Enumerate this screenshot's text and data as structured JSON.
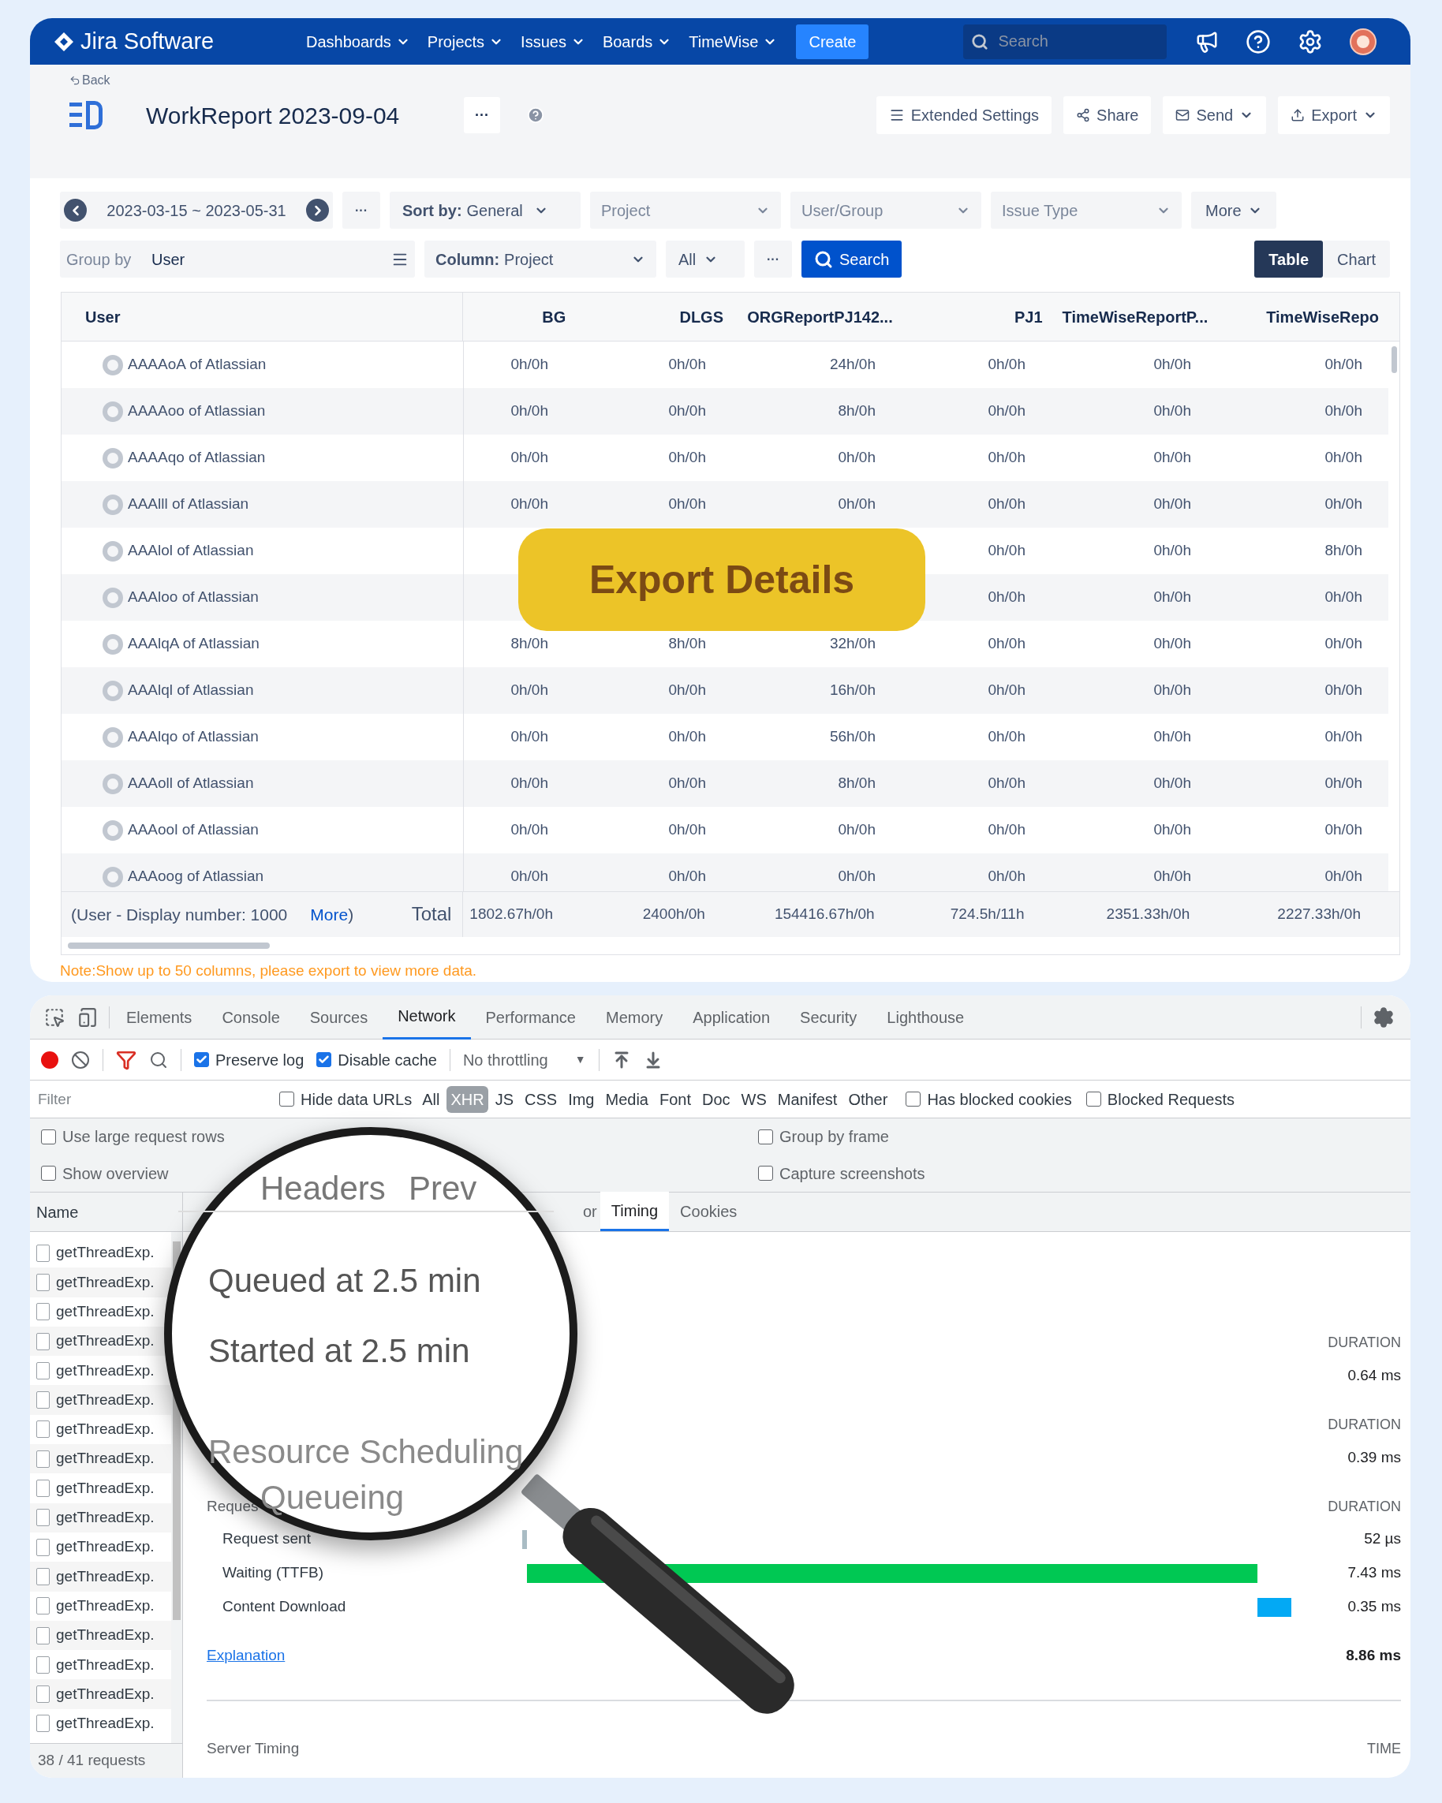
{
  "nav": {
    "logo": "Jira Software",
    "items": [
      {
        "label": "Dashboards"
      },
      {
        "label": "Projects"
      },
      {
        "label": "Issues"
      },
      {
        "label": "Boards"
      },
      {
        "label": "TimeWise"
      }
    ],
    "create": "Create",
    "search_placeholder": "Search"
  },
  "header": {
    "back": "Back",
    "title": "WorkReport 2023-09-04",
    "more": "···",
    "actions": [
      {
        "label": "Extended Settings",
        "kind": "settings"
      },
      {
        "label": "Share",
        "kind": "share"
      },
      {
        "label": "Send",
        "kind": "send"
      },
      {
        "label": "Export",
        "kind": "export"
      }
    ]
  },
  "filters": {
    "date_range": "2023-03-15 ~ 2023-05-31",
    "more": "···",
    "sort_label": "Sort by:",
    "sort_value": "General",
    "dropdowns": [
      {
        "placeholder": "Project"
      },
      {
        "placeholder": "User/Group"
      },
      {
        "placeholder": "Issue Type"
      }
    ],
    "more_button": "More",
    "group_label": "Group by",
    "group_value": "User",
    "column_label": "Column:",
    "column_value": "Project",
    "scope": "All",
    "options": "···",
    "search": "Search",
    "views": [
      {
        "label": "Table",
        "selected": true
      },
      {
        "label": "Chart",
        "selected": false
      }
    ]
  },
  "table": {
    "columns": [
      "User",
      "BG",
      "DLGS",
      "ORGReportPJ142...",
      "PJ1",
      "TimeWiseReportP...",
      "TimeWiseRepo"
    ],
    "rows": [
      {
        "user": "AAAAoA of Atlassian",
        "values": [
          "0h/0h",
          "0h/0h",
          "24h/0h",
          "0h/0h",
          "0h/0h",
          "0h/0h"
        ]
      },
      {
        "user": "AAAAoo of Atlassian",
        "values": [
          "0h/0h",
          "0h/0h",
          "8h/0h",
          "0h/0h",
          "0h/0h",
          "0h/0h"
        ]
      },
      {
        "user": "AAAAqo of Atlassian",
        "values": [
          "0h/0h",
          "0h/0h",
          "0h/0h",
          "0h/0h",
          "0h/0h",
          "0h/0h"
        ]
      },
      {
        "user": "AAAlll of Atlassian",
        "values": [
          "0h/0h",
          "0h/0h",
          "0h/0h",
          "0h/0h",
          "0h/0h",
          "0h/0h"
        ]
      },
      {
        "user": "AAAlol of Atlassian",
        "values": [
          "0h/0h",
          "0h/0h",
          "8h/0h"
        ]
      },
      {
        "user": "AAAloo of Atlassian",
        "values": [
          "0h/0h",
          "0h/0h",
          "0h/0h"
        ]
      },
      {
        "user": "AAAlqA of Atlassian",
        "values": [
          "8h/0h",
          "8h/0h",
          "32h/0h",
          "0h/0h",
          "0h/0h",
          "0h/0h"
        ]
      },
      {
        "user": "AAAlql of Atlassian",
        "values": [
          "0h/0h",
          "0h/0h",
          "16h/0h",
          "0h/0h",
          "0h/0h",
          "0h/0h"
        ]
      },
      {
        "user": "AAAlqo of Atlassian",
        "values": [
          "0h/0h",
          "0h/0h",
          "56h/0h",
          "0h/0h",
          "0h/0h",
          "0h/0h"
        ]
      },
      {
        "user": "AAAoll of Atlassian",
        "values": [
          "0h/0h",
          "0h/0h",
          "8h/0h",
          "0h/0h",
          "0h/0h",
          "0h/0h"
        ]
      },
      {
        "user": "AAAool of Atlassian",
        "values": [
          "0h/0h",
          "0h/0h",
          "0h/0h",
          "0h/0h",
          "0h/0h",
          "0h/0h"
        ]
      },
      {
        "user": "AAAoog of Atlassian",
        "values": [
          "0h/0h",
          "0h/0h",
          "0h/0h",
          "0h/0h",
          "0h/0h",
          "0h/0h"
        ]
      }
    ],
    "footer": {
      "display": "(User - Display number: 1000",
      "more": "More",
      "close": ")",
      "total_label": "Total",
      "totals": [
        "1802.67h/0h",
        "2400h/0h",
        "154416.67h/0h",
        "724.5h/11h",
        "2351.33h/0h",
        "2227.33h/0h"
      ]
    }
  },
  "note": "Note:Show up to 50 columns, please export to view more data.",
  "banner": "Export Details",
  "devtools": {
    "tabs": [
      {
        "label": "Elements",
        "selected": false
      },
      {
        "label": "Console",
        "selected": false
      },
      {
        "label": "Sources",
        "selected": false
      },
      {
        "label": "Network",
        "selected": true
      },
      {
        "label": "Performance",
        "selected": false
      },
      {
        "label": "Memory",
        "selected": false
      },
      {
        "label": "Application",
        "selected": false
      },
      {
        "label": "Security",
        "selected": false
      },
      {
        "label": "Lighthouse",
        "selected": false
      }
    ],
    "toolbar": {
      "checks": [
        {
          "label": "Preserve log",
          "checked": true
        },
        {
          "label": "Disable cache",
          "checked": true
        }
      ],
      "throttling": "No throttling",
      "throttling_caret": "▼"
    },
    "filter": {
      "placeholder": "Filter",
      "hide_data_urls": {
        "label": "Hide data URLs",
        "checked": false
      },
      "types": [
        {
          "label": "All",
          "selected": false
        },
        {
          "label": "XHR",
          "selected": true
        },
        {
          "label": "JS",
          "selected": false
        },
        {
          "label": "CSS",
          "selected": false
        },
        {
          "label": "Img",
          "selected": false
        },
        {
          "label": "Media",
          "selected": false
        },
        {
          "label": "Font",
          "selected": false
        },
        {
          "label": "Doc",
          "selected": false
        },
        {
          "label": "WS",
          "selected": false
        },
        {
          "label": "Manifest",
          "selected": false
        },
        {
          "label": "Other",
          "selected": false
        }
      ],
      "checks": [
        {
          "label": "Has blocked cookies",
          "checked": false
        },
        {
          "label": "Blocked Requests",
          "checked": false
        }
      ]
    },
    "options": [
      {
        "label": "Use large request rows",
        "checked": false
      },
      {
        "label": "Group by frame",
        "checked": false
      },
      {
        "label": "Show overview",
        "checked": false
      },
      {
        "label": "Capture screenshots",
        "checked": false
      }
    ],
    "requests": {
      "header": "Name",
      "items": [
        "getThreadExp.",
        "getThreadExp.",
        "getThreadExp.",
        "getThreadExp.",
        "getThreadExp.",
        "getThreadExp.",
        "getThreadExp.",
        "getThreadExp.",
        "getThreadExp.",
        "getThreadExp.",
        "getThreadExp.",
        "getThreadExp.",
        "getThreadExp.",
        "getThreadExp.",
        "getThreadExp.",
        "getThreadExp.",
        "getThreadExp."
      ],
      "status": "38 / 41 requests"
    },
    "detail_tabs": [
      {
        "label": "or",
        "selected": false
      },
      {
        "label": "Timing",
        "selected": true
      },
      {
        "label": "Cookies",
        "selected": false
      }
    ],
    "timing": {
      "sections": [
        {
          "header": "DURATION",
          "value": "0.64 ms"
        },
        {
          "header": "DURATION",
          "value": "0.39 ms"
        }
      ],
      "request": {
        "title": "Reques",
        "header": "DURATION",
        "rows": [
          {
            "label": "Request sent",
            "value": "52 µs"
          },
          {
            "label": "Waiting (TTFB)",
            "value": "7.43 ms"
          },
          {
            "label": "Content Download",
            "value": "0.35 ms"
          }
        ]
      },
      "explanation": "Explanation",
      "total": "8.86 ms",
      "server_timing": "Server Timing",
      "time_header": "TIME"
    }
  },
  "lens": {
    "tabs": [
      "Headers",
      "Prev"
    ],
    "lines": [
      "Queued at 2.5 min",
      "Started at 2.5 min",
      "Resource Scheduling",
      "Queueing"
    ]
  }
}
